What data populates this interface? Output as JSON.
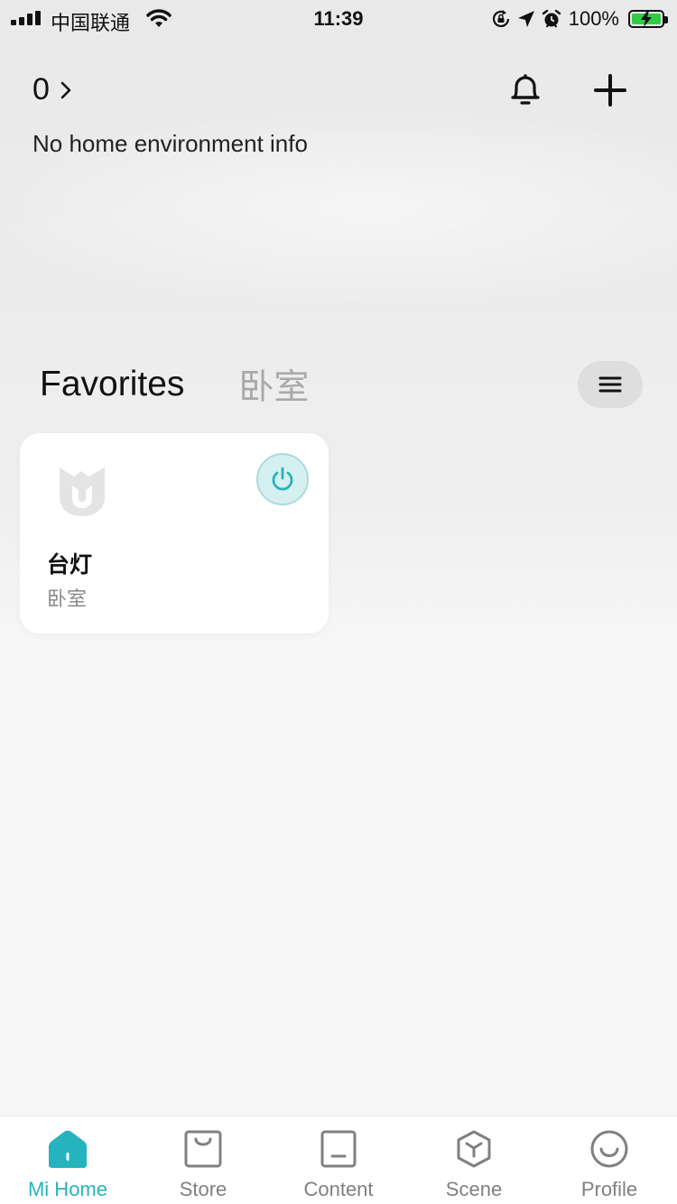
{
  "colors": {
    "accent": "#25b4bd",
    "power_button_bg": "#d6eff0",
    "battery_green": "#2fcc44",
    "inactive_text": "#a9a9a9"
  },
  "status_bar": {
    "carrier": "中国联通",
    "time": "11:39",
    "battery_percent": "100%",
    "icons": [
      "signal-icon",
      "wifi-icon",
      "orientation-lock-icon",
      "location-arrow-icon",
      "alarm-icon",
      "battery-charging-icon"
    ]
  },
  "header": {
    "home_count": "0",
    "env_info": "No home environment info",
    "icons": [
      "chevron-right-icon",
      "bell-icon",
      "plus-icon"
    ]
  },
  "tabs": {
    "items": [
      {
        "label": "Favorites",
        "active": true
      },
      {
        "label": "卧室",
        "active": false
      }
    ],
    "menu_icon": "menu-icon"
  },
  "devices": [
    {
      "name": "台灯",
      "room": "卧室",
      "icon": "mi-logo-icon",
      "power_icon": "power-icon"
    }
  ],
  "bottom_nav": {
    "items": [
      {
        "label": "Mi Home",
        "icon": "home-icon",
        "active": true
      },
      {
        "label": "Store",
        "icon": "shopping-bag-icon",
        "active": false
      },
      {
        "label": "Content",
        "icon": "content-icon",
        "active": false
      },
      {
        "label": "Scene",
        "icon": "cube-icon",
        "active": false
      },
      {
        "label": "Profile",
        "icon": "smile-icon",
        "active": false
      }
    ]
  }
}
